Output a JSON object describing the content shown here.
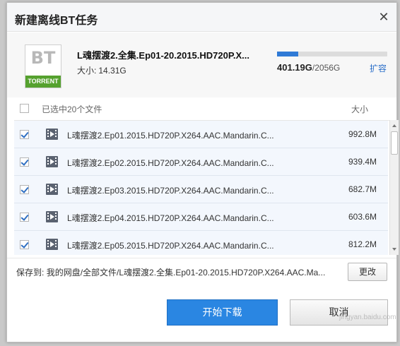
{
  "dialog": {
    "title": "新建离线BT任务",
    "close_icon": "close-icon"
  },
  "torrent": {
    "icon_top": "BT",
    "icon_bottom": "TORRENT",
    "name": "L魂摆渡2.全集.Ep01-20.2015.HD720P.X...",
    "size_label": "大小:",
    "size_value": "14.31G"
  },
  "quota": {
    "used": "401.19G",
    "separator": "/",
    "total": "2056G",
    "fraction": 0.195,
    "expand_label": "扩容"
  },
  "list_header": {
    "selected_text": "已选中20个文件",
    "size_header": "大小"
  },
  "files": [
    {
      "name": "L魂摆渡2.Ep01.2015.HD720P.X264.AAC.Mandarin.C...",
      "size": "992.8M",
      "checked": true
    },
    {
      "name": "L魂摆渡2.Ep02.2015.HD720P.X264.AAC.Mandarin.C...",
      "size": "939.4M",
      "checked": true
    },
    {
      "name": "L魂摆渡2.Ep03.2015.HD720P.X264.AAC.Mandarin.C...",
      "size": "682.7M",
      "checked": true
    },
    {
      "name": "L魂摆渡2.Ep04.2015.HD720P.X264.AAC.Mandarin.C...",
      "size": "603.6M",
      "checked": true
    },
    {
      "name": "L魂摆渡2.Ep05.2015.HD720P.X264.AAC.Mandarin.C...",
      "size": "812.2M",
      "checked": true
    }
  ],
  "save": {
    "label": "保存到:",
    "path": "我的网盘/全部文件/L魂摆渡2.全集.Ep01-20.2015.HD720P.X264.AAC.Ma...",
    "change_label": "更改"
  },
  "actions": {
    "start_label": "开始下载",
    "cancel_label": "取消"
  },
  "watermark": "jingyan.baidu.com",
  "colors": {
    "accent": "#2a86e2",
    "link": "#2b6fc9",
    "torrent_green": "#55a12e"
  }
}
